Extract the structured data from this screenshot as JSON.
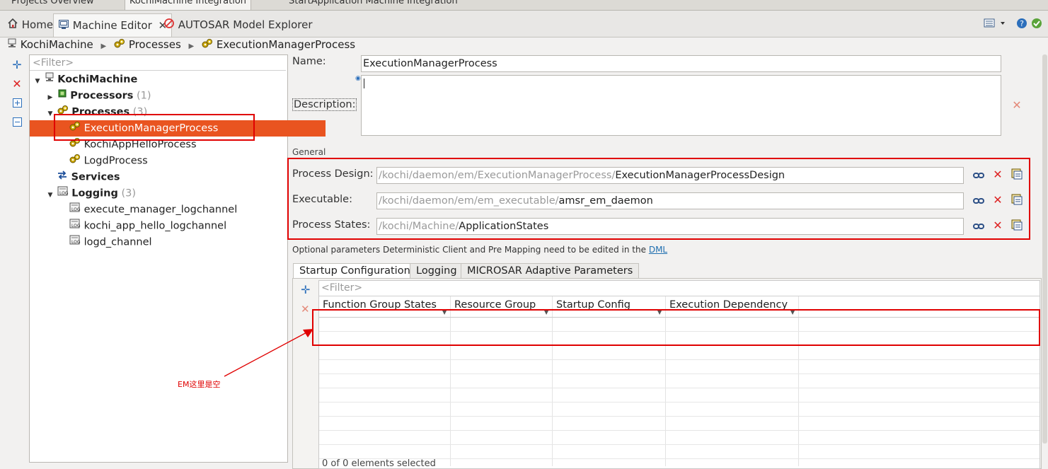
{
  "editor_tabs": [
    "Projects Overview",
    "KochiMachine Integration",
    "StartApplication Machine Integration"
  ],
  "view_tabs": {
    "home": "Home",
    "machine_editor": "Machine Editor",
    "model_explorer": "AUTOSAR Model Explorer"
  },
  "breadcrumb": [
    "KochiMachine",
    "Processes",
    "ExecutionManagerProcess"
  ],
  "tree": {
    "filter_placeholder": "<Filter>",
    "root": "KochiMachine",
    "processors": {
      "label": "Processors",
      "count": "(1)"
    },
    "processes": {
      "label": "Processes",
      "count": "(3)"
    },
    "process_items": [
      "ExecutionManagerProcess",
      "KochiAppHelloProcess",
      "LogdProcess"
    ],
    "services": "Services",
    "logging": {
      "label": "Logging",
      "count": "(3)"
    },
    "logging_items": [
      "execute_manager_logchannel",
      "kochi_app_hello_logchannel",
      "logd_channel"
    ]
  },
  "form": {
    "name_label": "Name:",
    "name_value": "ExecutionManagerProcess",
    "description_label": "Description:",
    "general_label": "General",
    "process_design_label": "Process Design:",
    "process_design_prefix": "/kochi/daemon/em/ExecutionManagerProcess/",
    "process_design_value": "ExecutionManagerProcessDesign",
    "executable_label": "Executable:",
    "executable_prefix": "/kochi/daemon/em/em_executable/",
    "executable_value": "amsr_em_daemon",
    "process_states_label": "Process States:",
    "process_states_prefix": "/kochi/Machine/",
    "process_states_value": "ApplicationStates",
    "optional_note": "Optional parameters Deterministic Client and Pre Mapping need to be edited in the",
    "dml_link": "DML"
  },
  "bottom_tabs": [
    "Startup Configuration",
    "Logging",
    "MICROSAR Adaptive Parameters"
  ],
  "grid": {
    "filter_placeholder": "<Filter>",
    "columns": [
      "Function Group States",
      "Resource Group",
      "Startup Config",
      "Execution Dependency"
    ],
    "footer": "0 of 0 elements selected"
  },
  "annotation": "EM这里是空",
  "colors": {
    "selection": "#e95420",
    "annotation": "#e00000"
  }
}
